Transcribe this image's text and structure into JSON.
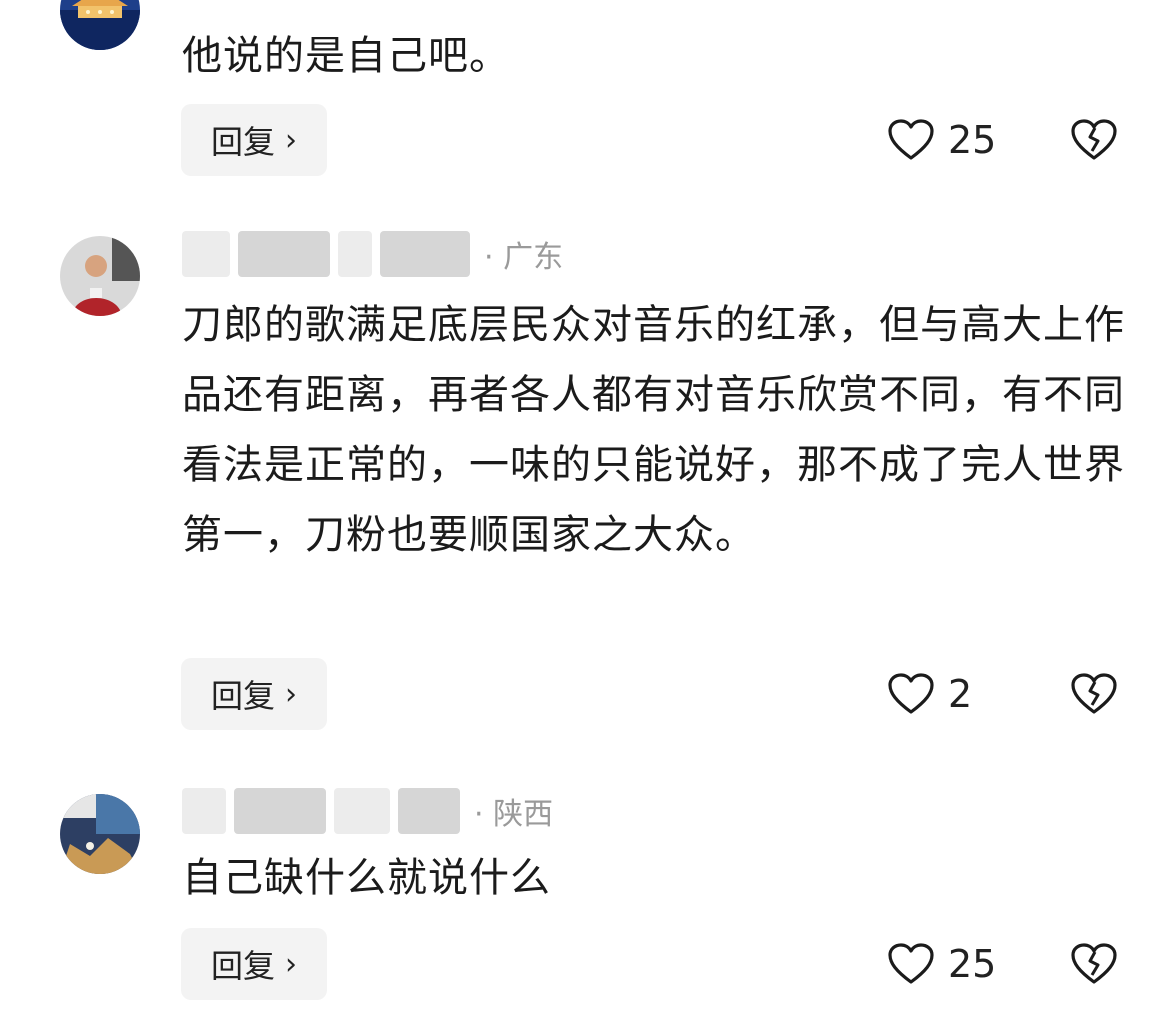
{
  "comments": [
    {
      "region": "",
      "text": "他说的是自己吧。",
      "reply_label": "回复",
      "like_count": "25"
    },
    {
      "region": "· 广东",
      "text": "刀郎的歌满足底层民众对音乐的红承，但与高大上作品还有距离，再者各人都有对音乐欣赏不同，有不同看法是正常的，一味的只能说好，那不成了完人世界第一，刀粉也要顺国家之大众。",
      "reply_label": "回复",
      "like_count": "2"
    },
    {
      "region": "· 陕西",
      "text": "自己缺什么就说什么",
      "reply_label": "回复",
      "like_count": "25"
    }
  ],
  "icons": {
    "like": "heart-outline-icon",
    "dislike": "broken-heart-icon",
    "chevron": "chevron-right-icon"
  },
  "colors": {
    "background": "#ffffff",
    "text": "#1b1b1b",
    "meta_text": "#9a9a9a",
    "reply_bg": "#f3f3f3"
  }
}
